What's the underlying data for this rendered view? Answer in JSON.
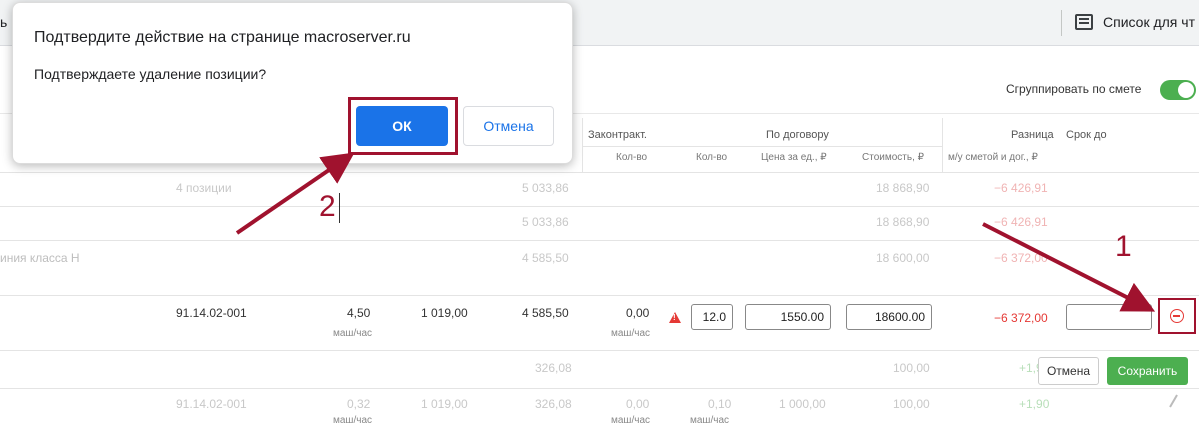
{
  "browser": {
    "left_fragment": "ь",
    "reading_list_label": "Список для чт"
  },
  "toolbar": {
    "group_toggle_label": "Сгруппировать по смете",
    "group_toggle_on": true
  },
  "table_header": {
    "contracted": "Законтракт.",
    "by_contract": "По договору",
    "difference": "Разница",
    "due_date": "Срок до",
    "sub_qty": "Кол-во",
    "sub_qty2": "Кол-во",
    "sub_unit_price": "Цена за ед., ₽",
    "sub_cost": "Стоимость, ₽",
    "sub_diff": "м/у сметой и дог., ₽"
  },
  "rows": {
    "r1": {
      "count": "4 позиции",
      "sum": "5 033,86",
      "cost": "18 868,90",
      "diff": "−6 426,91"
    },
    "r2": {
      "sum": "5 033,86",
      "cost": "18 868,90",
      "diff": "−6 426,91"
    },
    "r3": {
      "name": "иния класса Н",
      "sum": "4 585,50",
      "cost": "18 600,00",
      "diff": "−6 372,00"
    },
    "active": {
      "code": "91.14.02-001",
      "qty": "4,50",
      "qty_unit": "маш/час",
      "price": "1 019,00",
      "sum": "4 585,50",
      "contracted_qty": "0,00",
      "contracted_unit": "маш/час",
      "contract_qty_value": "12.0",
      "unit_price_value": "1550.00",
      "cost_value": "18600.00",
      "diff": "−6 372,00"
    },
    "r5": {
      "sum": "326,08",
      "cost": "100,00",
      "diff": "+1,90"
    },
    "r6": {
      "code": "91.14.02-001",
      "qty": "0,32",
      "price": "1 019,00",
      "sum": "326,08",
      "contracted_qty": "0,00",
      "qty2": "0,10",
      "unit_price": "1 000,00",
      "cost": "100,00",
      "diff": "+1,90",
      "unit1": "маш/час",
      "unit2": "маш/час",
      "unit3": "маш/час"
    }
  },
  "row_actions": {
    "cancel_label": "Отмена",
    "save_label": "Сохранить"
  },
  "dialog": {
    "title": "Подтвердите действие на странице macroserver.ru",
    "message": "Подтверждаете удаление позиции?",
    "ok_label": "ОК",
    "cancel_label": "Отмена"
  },
  "annotations": {
    "step1": "1",
    "step2": "2"
  },
  "colors": {
    "accent_blue": "#1a73e8",
    "annotation": "#a0122e",
    "negative": "#e53935",
    "success": "#4caf50"
  }
}
